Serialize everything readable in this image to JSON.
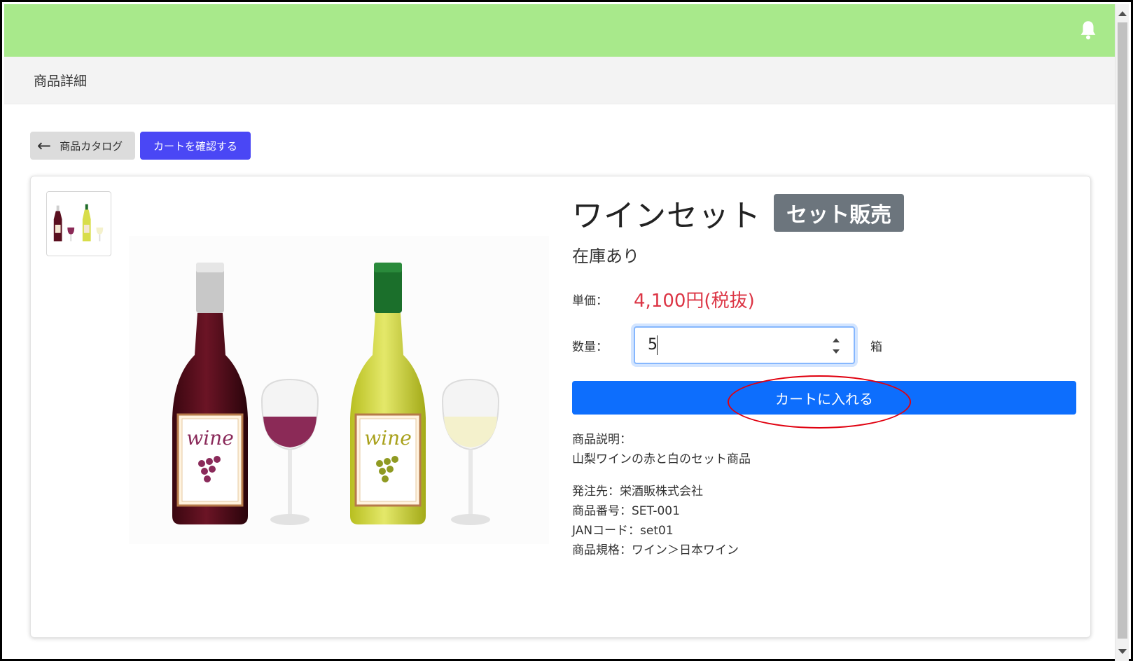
{
  "header": {
    "bell_icon": "bell-icon",
    "page_title": "商品詳細"
  },
  "toolbar": {
    "back_label": "商品カタログ",
    "cart_label": "カートを確認する"
  },
  "product": {
    "title": "ワインセット",
    "badge": "セット販売",
    "stock": "在庫あり",
    "price_label": "単価：",
    "price": "4,100円(税抜)",
    "qty_label": "数量：",
    "qty_value": "5",
    "unit": "箱",
    "add_button": "カートに入れる",
    "desc_label": "商品説明：",
    "desc": "山梨ワインの赤と白のセット商品",
    "supplier": "発注先：栄酒販株式会社",
    "sku": "商品番号：SET-001",
    "jan": "JANコード：set01",
    "spec": "商品規格：ワイン＞日本ワイン",
    "image_label": "wine"
  },
  "colors": {
    "topbar": "#a8e98b",
    "primary": "#0d6efd",
    "cart_button": "#4a47f5",
    "price": "#dc3545",
    "badge": "#6c757d",
    "highlight": "#e0000f"
  }
}
